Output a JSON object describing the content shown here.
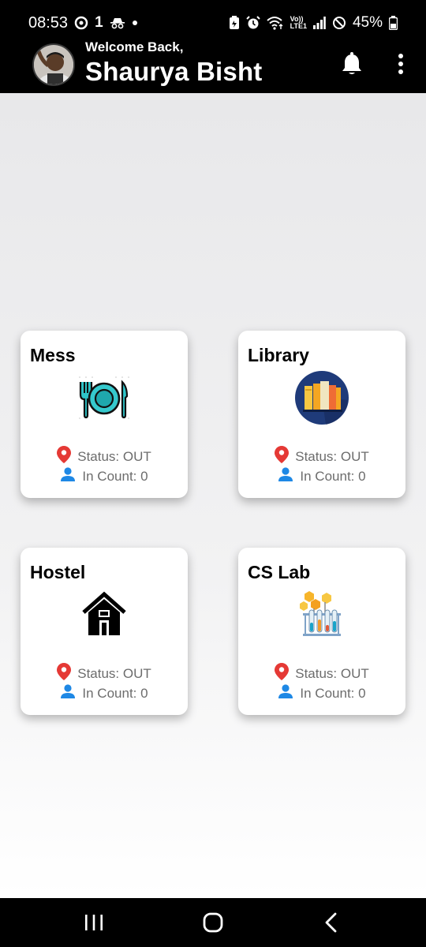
{
  "status_bar": {
    "time": "08:53",
    "notif_count": "1",
    "net_top": "Vo))",
    "net_bottom": "LTE1",
    "battery": "45%",
    "icons": [
      "sync-icon",
      "incognito-icon",
      "dot-icon",
      "battery-saver-icon",
      "alarm-icon",
      "wifi-icon",
      "signal-icon",
      "dnd-icon",
      "battery-icon"
    ]
  },
  "header": {
    "welcome": "Welcome Back,",
    "user_name": "Shaurya Bisht",
    "icons": [
      "bell-icon",
      "more-vert-icon"
    ]
  },
  "locations": [
    {
      "title": "Mess",
      "icon": "plate-icon",
      "status": "Status: OUT",
      "count": "In Count: 0"
    },
    {
      "title": "Library",
      "icon": "books-icon",
      "status": "Status: OUT",
      "count": "In Count: 0"
    },
    {
      "title": "Hostel",
      "icon": "house-icon",
      "status": "Status: OUT",
      "count": "In Count: 0"
    },
    {
      "title": "CS Lab",
      "icon": "lab-icon",
      "status": "Status: OUT",
      "count": "In Count: 0"
    }
  ],
  "nav": {
    "icons": [
      "recents-icon",
      "home-icon",
      "back-icon"
    ]
  },
  "colors": {
    "pin": "#e53935",
    "person": "#1e88e5",
    "bar_bg": "#000000"
  }
}
